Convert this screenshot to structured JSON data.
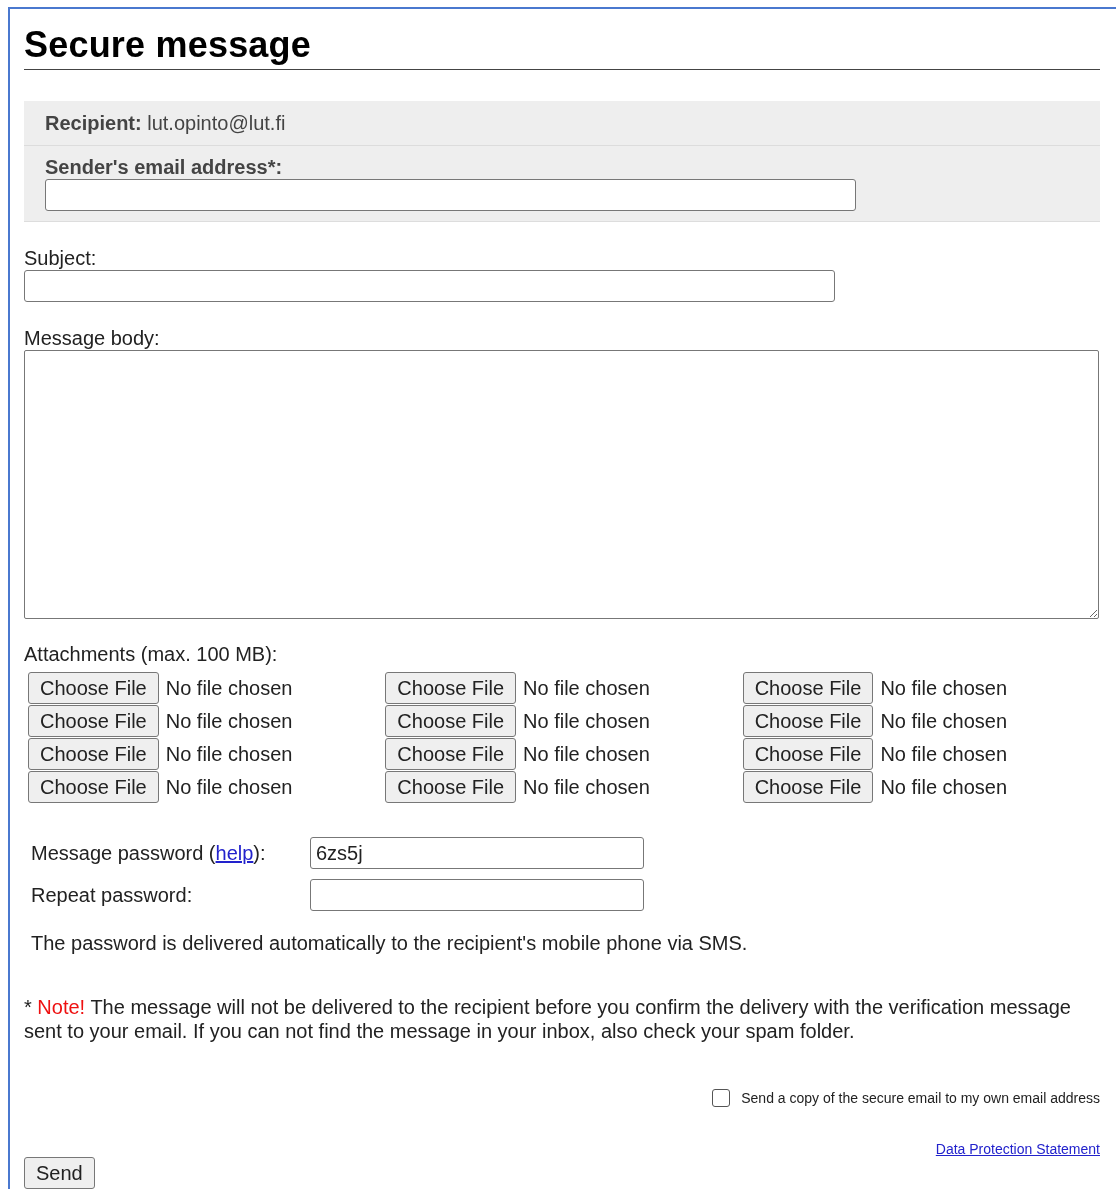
{
  "title": "Secure message",
  "recipient": {
    "label": "Recipient:",
    "value": "lut.opinto@lut.fi"
  },
  "sender": {
    "label": "Sender's email address*:"
  },
  "subject": {
    "label": "Subject:"
  },
  "body": {
    "label": "Message body:"
  },
  "attachments": {
    "label": "Attachments (max. 100 MB):",
    "columns": [
      [
        {
          "button": "Choose File",
          "status": "No file chosen"
        },
        {
          "button": "Choose File",
          "status": "No file chosen"
        },
        {
          "button": "Choose File",
          "status": "No file chosen"
        },
        {
          "button": "Choose File",
          "status": "No file chosen"
        }
      ],
      [
        {
          "button": "Choose File",
          "status": "No file chosen"
        },
        {
          "button": "Choose File",
          "status": "No file chosen"
        },
        {
          "button": "Choose File",
          "status": "No file chosen"
        },
        {
          "button": "Choose File",
          "status": "No file chosen"
        }
      ],
      [
        {
          "button": "Choose File",
          "status": "No file chosen"
        },
        {
          "button": "Choose File",
          "status": "No file chosen"
        },
        {
          "button": "Choose File",
          "status": "No file chosen"
        },
        {
          "button": "Choose File",
          "status": "No file chosen"
        }
      ]
    ]
  },
  "password": {
    "label_before": "Message password (",
    "help_link": "help",
    "label_after": "):",
    "value": "6zs5j"
  },
  "repeat_password": {
    "label": "Repeat password:"
  },
  "password_info": "The password is delivered automatically to the recipient's mobile phone via SMS.",
  "note": {
    "prefix": "*",
    "label": "Note!",
    "text": "The message will not be delivered to the recipient before you confirm the delivery with the verification message sent to your email. If you can not find the message in your inbox, also check your spam folder."
  },
  "copy_option": {
    "label": "Send a copy of the secure email to my own email address",
    "checked": false
  },
  "data_protection_link": "Data Protection Statement",
  "send_button": "Send"
}
